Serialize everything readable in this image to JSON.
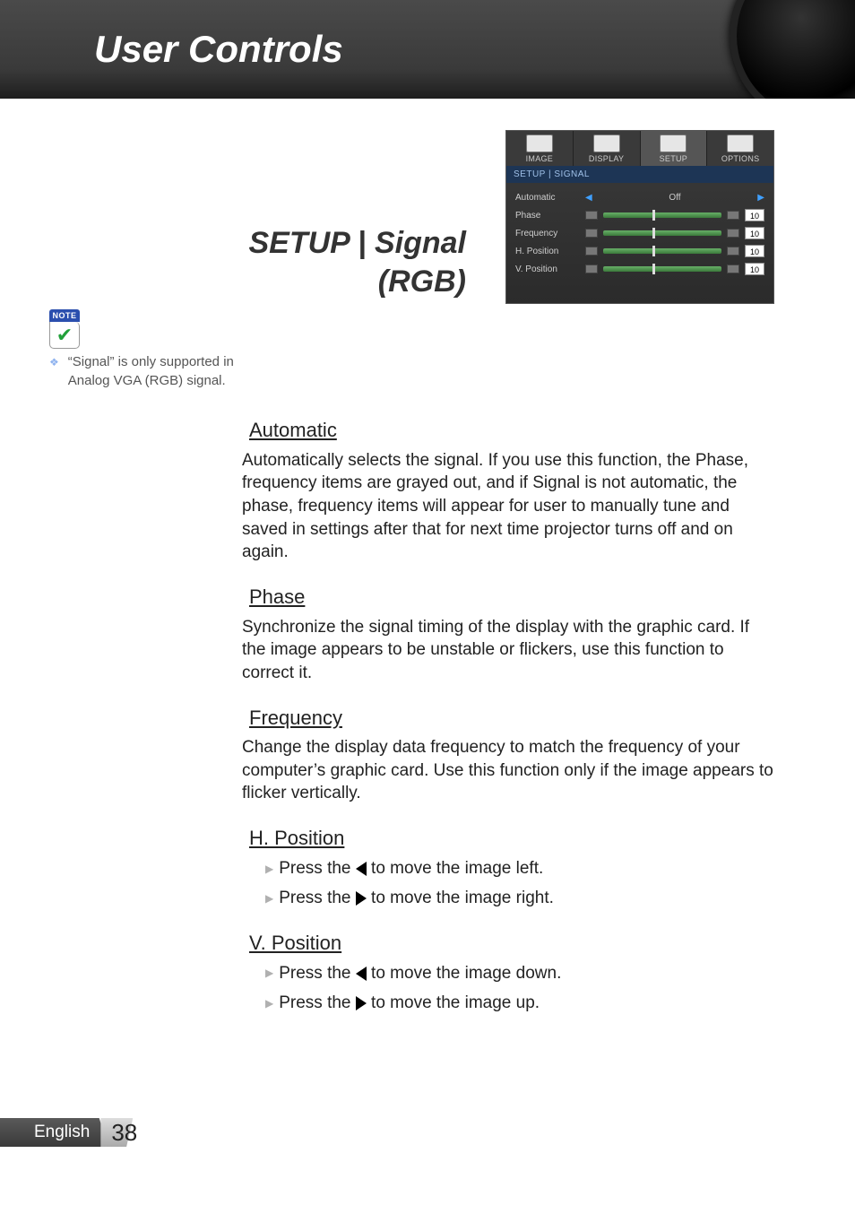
{
  "header": {
    "title": "User Controls"
  },
  "section_title_line1": "SETUP | Signal",
  "section_title_line2": "(RGB)",
  "osd": {
    "tabs": [
      "IMAGE",
      "DISPLAY",
      "SETUP",
      "OPTIONS"
    ],
    "breadcrumb": "SETUP | SIGNAL",
    "rows": {
      "automatic": {
        "label": "Automatic",
        "value": "Off"
      },
      "phase": {
        "label": "Phase",
        "value": "10"
      },
      "frequency": {
        "label": "Frequency",
        "value": "10"
      },
      "hposition": {
        "label": "H. Position",
        "value": "10"
      },
      "vposition": {
        "label": "V. Position",
        "value": "10"
      }
    }
  },
  "note": {
    "badge": "NOTE",
    "text": "“Signal” is only supported in Analog VGA (RGB) signal."
  },
  "sections": {
    "automatic": {
      "heading": "Automatic",
      "body": "Automatically selects the signal. If you use this function, the Phase, frequency items are grayed out, and if Signal is not automatic, the phase, frequency items will appear for user to manually tune and saved in settings after that for next time projector turns off and on again."
    },
    "phase": {
      "heading": "Phase",
      "body": "Synchronize the signal timing of the display with the graphic card. If the image appears to be unstable or flickers, use this function to correct it."
    },
    "frequency": {
      "heading": "Frequency",
      "body": "Change the display data frequency to match the frequency of your computer’s graphic card. Use this function only if the image appears to flicker vertically."
    },
    "hposition": {
      "heading": "H. Position",
      "items": {
        "left_pre": "Press the ",
        "left_post": " to move the image left.",
        "right_pre": "Press the ",
        "right_post": " to move the image right."
      }
    },
    "vposition": {
      "heading": "V. Position",
      "items": {
        "down_pre": "Press the ",
        "down_post": " to move the image down.",
        "up_pre": "Press the ",
        "up_post": " to move the image up."
      }
    }
  },
  "footer": {
    "language": "English",
    "page": "38"
  }
}
